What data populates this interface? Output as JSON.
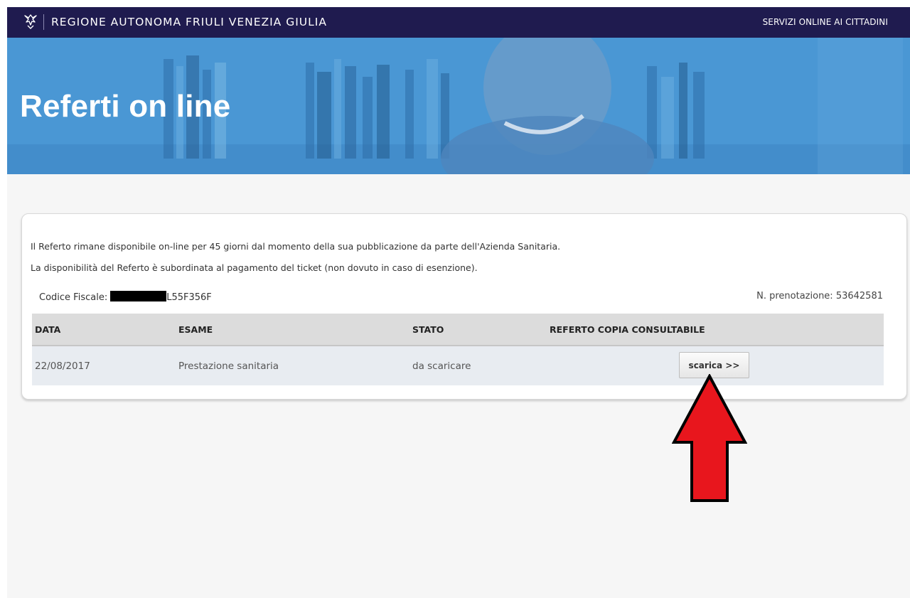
{
  "topbar": {
    "region_name": "REGIONE AUTONOMA FRIULI VENEZIA GIULIA",
    "services_link": "SERVIZI ONLINE AI CITTADINI"
  },
  "hero": {
    "title": "Referti on line"
  },
  "info": {
    "line1": "Il Referto rimane disponibile on-line per 45 giorni dal momento della sua pubblicazione da parte dell'Azienda Sanitaria.",
    "line2": "La disponibilità del Referto è subordinata al pagamento del ticket (non dovuto in caso di esenzione).",
    "codice_fiscale_label": "Codice Fiscale:",
    "codice_fiscale_value": "L55F356F",
    "prenotazione": "N. prenotazione: 53642581"
  },
  "table": {
    "headers": [
      "DATA",
      "ESAME",
      "STATO",
      "REFERTO COPIA CONSULTABILE"
    ],
    "rows": [
      {
        "data": "22/08/2017",
        "esame": "Prestazione sanitaria",
        "stato": "da scaricare",
        "action": "scarica >>"
      }
    ]
  },
  "colors": {
    "topbar": "#1f1b4f",
    "hero": "#3f8ccd",
    "annotation_arrow": "#e8161d"
  },
  "icons": {
    "logo": "region-eagle-logo",
    "annotation": "red-arrow-up"
  }
}
